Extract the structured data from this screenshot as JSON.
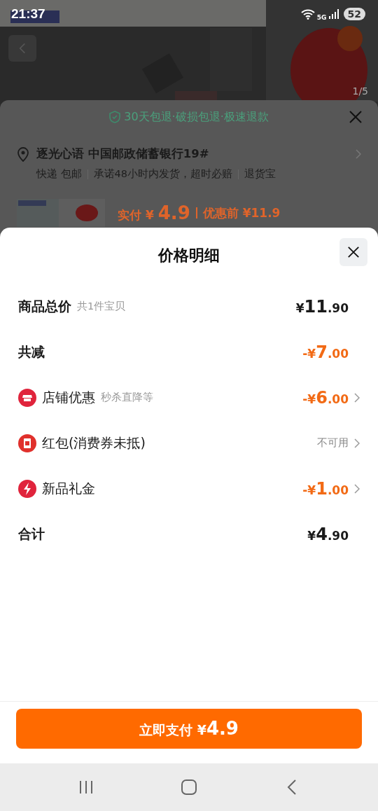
{
  "status_bar": {
    "time": "21:37",
    "network": "5G",
    "battery": "52"
  },
  "gallery": {
    "counter": "1/5"
  },
  "order_sheet": {
    "guarantee": "30天包退·破损包退·极速退款",
    "address": "逐光心语 中国邮政储蓄银行19#",
    "delivery": [
      "快递 包邮",
      "承诺48小时内发货，超时必赔",
      "退货宝"
    ],
    "paid_label": "实付",
    "paid_currency": "¥",
    "paid_amount": "4.9",
    "before_label": "优惠前",
    "before_amount": "¥11.9"
  },
  "price_detail": {
    "title": "价格明细",
    "rows": [
      {
        "kind": "total",
        "label": "商品总价",
        "note": "共1件宝贝",
        "amount": "¥11.90",
        "negative": false,
        "disabled": false,
        "link": false
      },
      {
        "kind": "reduction",
        "label": "共减",
        "amount": "-¥7.00",
        "negative": true,
        "disabled": false,
        "link": false
      },
      {
        "kind": "shop_discount",
        "label": "店铺优惠",
        "note": "秒杀直降等",
        "amount": "-¥6.00",
        "negative": true,
        "disabled": false,
        "link": true
      },
      {
        "kind": "red_packet",
        "label": "红包(消费券未抵)",
        "amount": "不可用",
        "negative": false,
        "disabled": true,
        "link": true
      },
      {
        "kind": "gift_money",
        "label": "新品礼金",
        "amount": "-¥1.00",
        "negative": true,
        "disabled": false,
        "link": true
      },
      {
        "kind": "sum",
        "label": "合计",
        "amount": "¥4.90",
        "negative": false,
        "disabled": false,
        "link": false
      }
    ]
  },
  "pay_button": {
    "label": "立即支付",
    "currency": "¥",
    "amount": "4.9"
  }
}
